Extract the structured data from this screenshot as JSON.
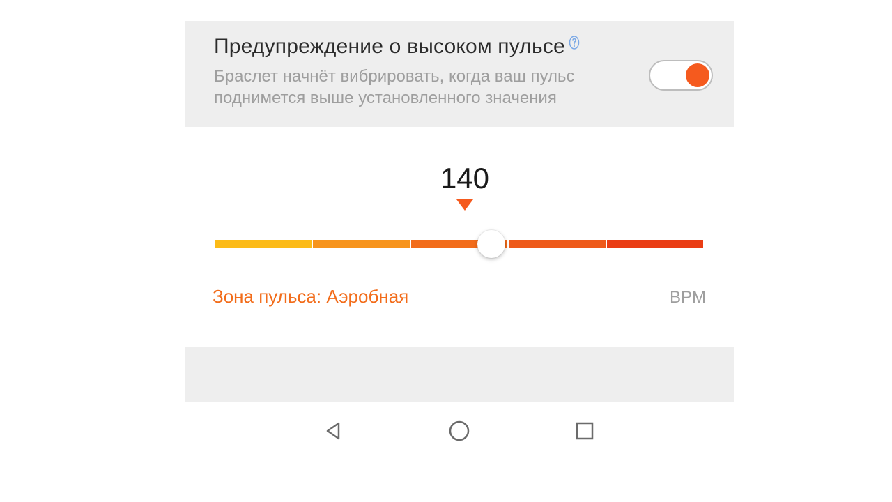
{
  "colors": {
    "accent": "#f55a1e",
    "muted": "#9e9e9e",
    "card_bg": "#eeeeee"
  },
  "alert": {
    "title": "Предупреждение о высоком пульсе",
    "description": "Браслет начнёт вибрировать, когда ваш пульс поднимется выше установленного значения",
    "toggle_on": true
  },
  "slider": {
    "value": "140",
    "zone_prefix": "Зона пульса: ",
    "zone_name": "Аэробная",
    "unit": "BPM"
  },
  "nav": {
    "back": "back",
    "home": "home",
    "recent": "recent"
  }
}
